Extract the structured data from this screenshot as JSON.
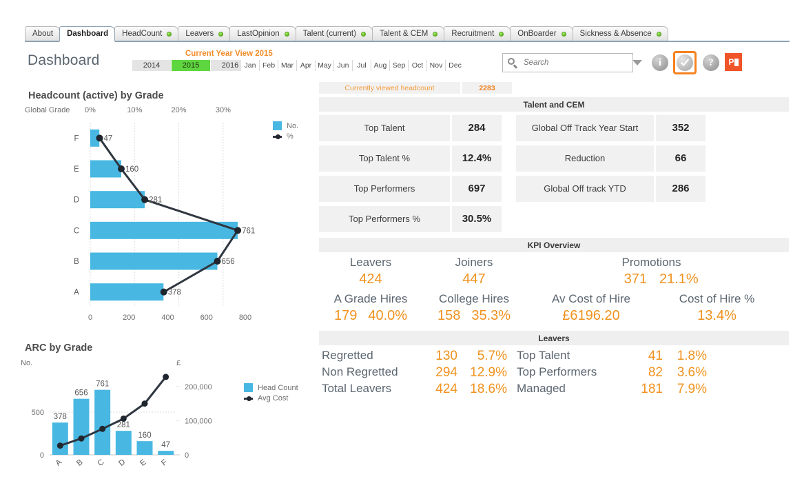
{
  "tabs": [
    {
      "label": "About",
      "active": false,
      "dot": false
    },
    {
      "label": "Dashboard",
      "active": true,
      "dot": false
    },
    {
      "label": "HeadCount",
      "active": false,
      "dot": true
    },
    {
      "label": "Leavers",
      "active": false,
      "dot": true
    },
    {
      "label": "LastOpinion",
      "active": false,
      "dot": true
    },
    {
      "label": "Talent (current)",
      "active": false,
      "dot": true
    },
    {
      "label": "Talent & CEM",
      "active": false,
      "dot": true
    },
    {
      "label": "Recruitment",
      "active": false,
      "dot": true
    },
    {
      "label": "OnBoarder",
      "active": false,
      "dot": true
    },
    {
      "label": "Sickness & Absence",
      "active": false,
      "dot": true
    }
  ],
  "header": {
    "page_title": "Dashboard",
    "year_view_label": "Current Year View 2015",
    "years": [
      "2014",
      "2015",
      "2016"
    ],
    "selected_year": "2015",
    "months": [
      "Jan",
      "Feb",
      "Mar",
      "Apr",
      "May",
      "Jun",
      "Jul",
      "Aug",
      "Sep",
      "Oct",
      "Nov",
      "Dec"
    ],
    "search_placeholder": "Search",
    "search_value": "",
    "info_icon_glyph": "i",
    "help_icon_glyph": "?",
    "ppt_icon_label": "P",
    "accent_orange": "#f5821f",
    "selected_year_green": "#5ed63f"
  },
  "chart_data": [
    {
      "type": "bar",
      "orientation": "horizontal",
      "title": "Headcount (active) by Grade",
      "xlabel": "",
      "ylabel": "Global Grade",
      "categories": [
        "F",
        "E",
        "D",
        "C",
        "B",
        "A"
      ],
      "series": [
        {
          "name": "No.",
          "values": [
            47,
            160,
            281,
            761,
            656,
            378
          ],
          "color": "#48b8e2",
          "axis": "bottom"
        },
        {
          "name": "%",
          "values": [
            2.1,
            7.0,
            12.3,
            33.3,
            28.7,
            16.6
          ],
          "color": "#2f3640",
          "axis": "top",
          "labels": [
            "47",
            "160",
            "281",
            "761",
            "656",
            "378"
          ]
        }
      ],
      "bottom_axis_ticks": [
        "0",
        "200",
        "400",
        "600",
        "800"
      ],
      "bottom_axis_range": [
        0,
        800
      ],
      "top_axis_ticks": [
        "0%",
        "10%",
        "20%",
        "30%"
      ],
      "top_axis_range": [
        0,
        35
      ],
      "legend": [
        "No.",
        "%"
      ],
      "legend_position": "right",
      "grid": true
    },
    {
      "type": "bar",
      "orientation": "vertical",
      "title": "ARC by Grade",
      "left_axis_label": "No.",
      "right_axis_label": "£",
      "categories": [
        "A",
        "B",
        "C",
        "D",
        "E",
        "F"
      ],
      "series": [
        {
          "name": "Head Count",
          "values": [
            378,
            656,
            761,
            281,
            160,
            47
          ],
          "color": "#48b8e2",
          "axis": "left",
          "labels": [
            "378",
            "656",
            "761",
            "281",
            "160",
            "47"
          ]
        },
        {
          "name": "Avg Cost",
          "values": [
            27000,
            48000,
            76000,
            106000,
            150000,
            228000
          ],
          "color": "#2f3640",
          "axis": "right"
        }
      ],
      "left_axis_ticks": [
        "0",
        "500"
      ],
      "left_axis_range": [
        0,
        1000
      ],
      "right_axis_ticks": [
        "0",
        "100,000",
        "200,000"
      ],
      "right_axis_range": [
        0,
        250000
      ],
      "legend": [
        "Head Count",
        "Avg Cost"
      ],
      "legend_position": "right",
      "grid": true
    }
  ],
  "right": {
    "viewed": {
      "label": "Currently viewed headcount",
      "value": "2283"
    },
    "talent": {
      "header": "Talent and CEM",
      "left_rows": [
        {
          "label": "Top Talent",
          "value": "284"
        },
        {
          "label": "Top Talent %",
          "value": "12.4%"
        },
        {
          "label": "Top Performers",
          "value": "697"
        },
        {
          "label": "Top Performers %",
          "value": "30.5%"
        }
      ],
      "right_rows": [
        {
          "label": "Global Off Track Year Start",
          "value": "352"
        },
        {
          "label": "Reduction",
          "value": "66"
        },
        {
          "label": "Global Off track YTD",
          "value": "286"
        }
      ]
    },
    "kpi": {
      "header": "KPI Overview",
      "row1_labels": [
        "Leavers",
        "Joiners",
        "Promotions"
      ],
      "row1_values": {
        "leavers": "424",
        "joiners": "447",
        "promotions_count": "371",
        "promotions_pct": "21.1%"
      },
      "row2_labels": [
        "A Grade Hires",
        "College Hires",
        "Av Cost of Hire",
        "Cost of Hire %"
      ],
      "row2_values": {
        "a_grade_hires": "179",
        "a_grade_hires_pct": "40.0%",
        "college_hires": "158",
        "college_hires_pct": "35.3%",
        "av_cost_of_hire": "£6196.20",
        "cost_of_hire_pct": "13.4%"
      }
    },
    "leavers": {
      "header": "Leavers",
      "rows": [
        {
          "label": "Regretted",
          "num": "130",
          "pct": "5.7%",
          "label2": "Top Talent",
          "num2": "41",
          "pct2": "1.8%"
        },
        {
          "label": "Non Regretted",
          "num": "294",
          "pct": "12.9%",
          "label2": "Top Performers",
          "num2": "82",
          "pct2": "3.6%"
        },
        {
          "label": "Total Leavers",
          "num": "424",
          "pct": "18.6%",
          "label2": "Managed",
          "num2": "181",
          "pct2": "7.9%"
        }
      ]
    }
  }
}
